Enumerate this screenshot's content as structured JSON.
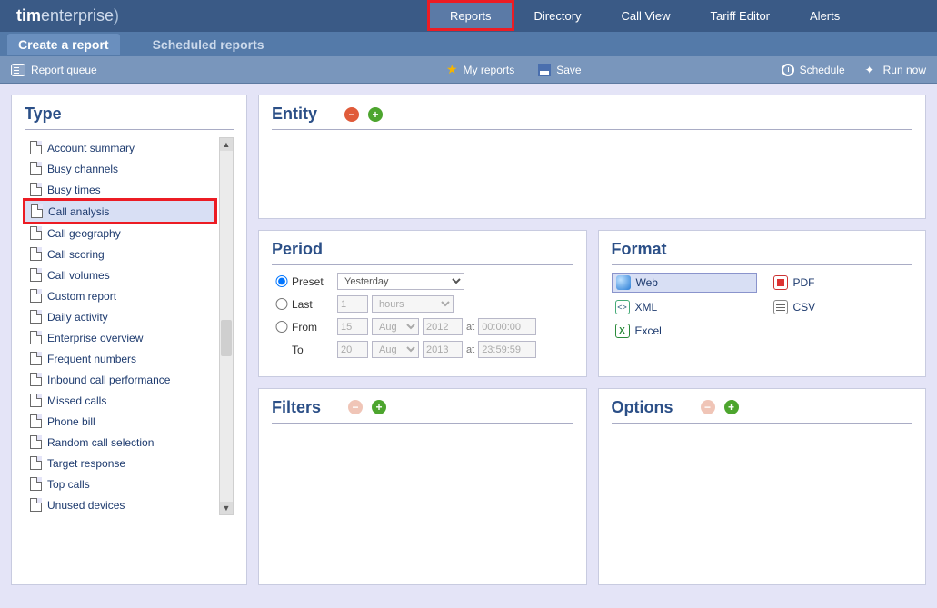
{
  "brand": {
    "prefix": "tim",
    "suffix": "enterprise"
  },
  "topnav": {
    "reports": "Reports",
    "directory": "Directory",
    "callview": "Call View",
    "tariff": "Tariff Editor",
    "alerts": "Alerts"
  },
  "subtabs": {
    "create": "Create a report",
    "scheduled": "Scheduled reports"
  },
  "toolbar": {
    "queue": "Report queue",
    "myreports": "My reports",
    "save": "Save",
    "schedule": "Schedule",
    "runnow": "Run now"
  },
  "panels": {
    "type": "Type",
    "entity": "Entity",
    "period": "Period",
    "format": "Format",
    "filters": "Filters",
    "options": "Options"
  },
  "type_items": [
    "Account summary",
    "Busy channels",
    "Busy times",
    "Call analysis",
    "Call geography",
    "Call scoring",
    "Call volumes",
    "Custom report",
    "Daily activity",
    "Enterprise overview",
    "Frequent numbers",
    "Inbound call performance",
    "Missed calls",
    "Phone bill",
    "Random call selection",
    "Target response",
    "Top calls",
    "Unused devices"
  ],
  "type_selected_index": 3,
  "period": {
    "labels": {
      "preset": "Preset",
      "last": "Last",
      "from": "From",
      "to": "To"
    },
    "preset_value": "Yesterday",
    "last_value": "1",
    "last_unit": "hours",
    "from": {
      "day": "15",
      "month": "Aug",
      "year": "2012",
      "time": "00:00:00"
    },
    "to": {
      "day": "20",
      "month": "Aug",
      "year": "2013",
      "time": "23:59:59"
    },
    "at": "at",
    "selected": "preset"
  },
  "format": {
    "web": "Web",
    "pdf": "PDF",
    "xml": "XML",
    "csv": "CSV",
    "excel": "Excel",
    "selected": "web"
  }
}
